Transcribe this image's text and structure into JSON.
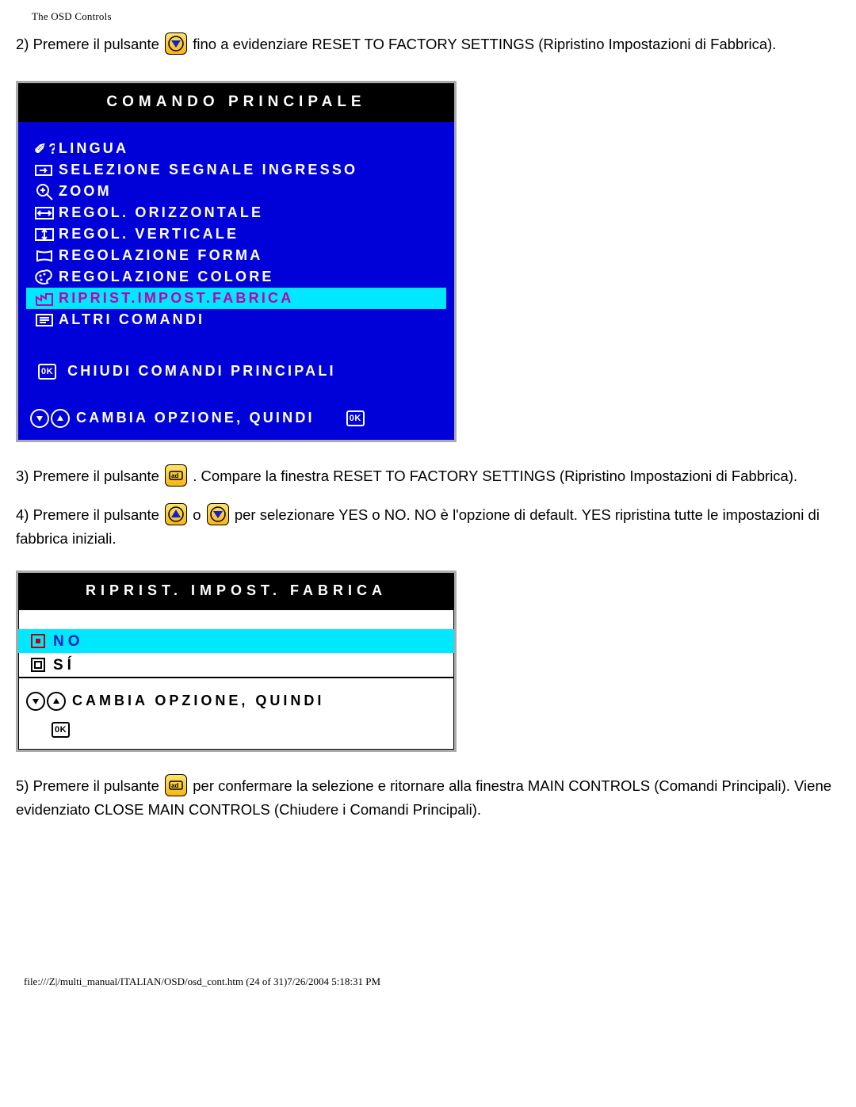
{
  "header": "The OSD Controls",
  "step2_a": "2) Premere il pulsante ",
  "step2_b": "fino a evidenziare RESET TO FACTORY SETTINGS (Ripristino Impostazioni di Fabbrica).",
  "osd1": {
    "title": "COMANDO PRINCIPALE",
    "items": [
      {
        "label": "LINGUA",
        "hl": false
      },
      {
        "label": "SELEZIONE SEGNALE INGRESSO",
        "hl": false
      },
      {
        "label": "ZOOM",
        "hl": false
      },
      {
        "label": "REGOL. ORIZZONTALE",
        "hl": false
      },
      {
        "label": "REGOL. VERTICALE",
        "hl": false
      },
      {
        "label": "REGOLAZIONE FORMA",
        "hl": false
      },
      {
        "label": "REGOLAZIONE COLORE",
        "hl": false
      },
      {
        "label": "RIPRIST.IMPOST.FABRICA",
        "hl": true
      },
      {
        "label": "ALTRI COMANDI",
        "hl": false
      }
    ],
    "close": "CHIUDI COMANDI PRINCIPALI",
    "footer": "CAMBIA OPZIONE, QUINDI"
  },
  "step3_a": "3) Premere il pulsante ",
  "step3_b": ". Compare la finestra RESET TO FACTORY SETTINGS (Ripristino Impostazioni di Fabbrica).",
  "step4_a": "4) Premere il pulsante ",
  "step4_mid": "o ",
  "step4_b": "per selezionare YES o NO. NO è l'opzione di default. YES ripristina tutte le impostazioni di fabbrica iniziali.",
  "osd2": {
    "title": "RIPRIST. IMPOST. FABRICA",
    "no": "NO",
    "si": "SÍ",
    "footer": "CAMBIA OPZIONE, QUINDI"
  },
  "step5_a": "5) Premere il pulsante ",
  "step5_b": " per confermare la selezione e ritornare alla finestra MAIN CONTROLS (Comandi Principali). Viene evidenziato CLOSE MAIN CONTROLS (Chiudere i Comandi Principali).",
  "footer": "file:///Z|/multi_manual/ITALIAN/OSD/osd_cont.htm (24 of 31)7/26/2004 5:18:31 PM"
}
